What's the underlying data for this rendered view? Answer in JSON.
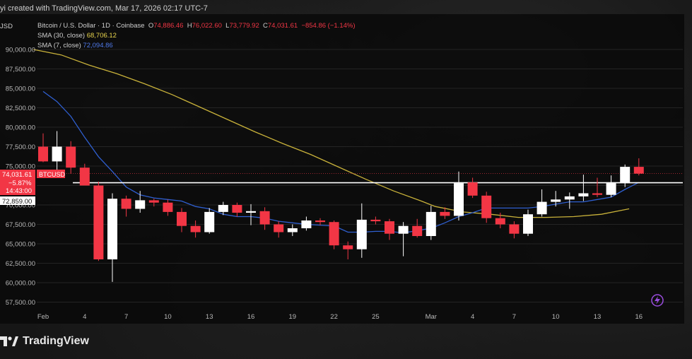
{
  "header": {
    "created_line": "yi created with TradingView.com, Mar 17, 2026 02:17 UTC-7",
    "symbol_currency": "JSD",
    "symbol_name": "Bitcoin / U.S. Dollar · 1D · Coinbase",
    "ohlc": {
      "o_label": "O",
      "o": "74,886.46",
      "h_label": "H",
      "h": "76,022.60",
      "l_label": "L",
      "l": "73,779.92",
      "c_label": "C",
      "c": "74,031.61",
      "change": "−854.86 (−1.14%)"
    },
    "sma30_label": "SMA (30, close)",
    "sma30_value": "68,706.12",
    "sma7_label": "SMA (7, close)",
    "sma7_value": "72,094.86"
  },
  "badges": {
    "price": "74,031.61",
    "ticker": "BTCUSD",
    "pct": "−5.87%",
    "countdown": "14:43:00",
    "line_price": "72,859.00"
  },
  "footer": {
    "brand": "TradingView"
  },
  "colors": {
    "up": "#ffffff",
    "down": "#f23645",
    "sma30": "#c9b23a",
    "sma7": "#2f5fd0",
    "hline": "#ffffff"
  },
  "chart_data": {
    "type": "candlestick",
    "y_ticks": [
      "90,000.00",
      "87,500.00",
      "85,000.00",
      "82,500.00",
      "80,000.00",
      "77,500.00",
      "75,000.00",
      "72,500.00",
      "70,000.00",
      "67,500.00",
      "65,000.00",
      "62,500.00",
      "60,000.00",
      "57,500.00"
    ],
    "y_tick_values": [
      90000,
      87500,
      85000,
      82500,
      80000,
      77500,
      75000,
      72500,
      70000,
      67500,
      65000,
      62500,
      60000,
      57500
    ],
    "x_ticks": [
      {
        "label": "Feb",
        "day": 0
      },
      {
        "label": "4",
        "day": 3
      },
      {
        "label": "7",
        "day": 6
      },
      {
        "label": "10",
        "day": 9
      },
      {
        "label": "13",
        "day": 12
      },
      {
        "label": "16",
        "day": 15
      },
      {
        "label": "19",
        "day": 18
      },
      {
        "label": "22",
        "day": 21
      },
      {
        "label": "25",
        "day": 24
      },
      {
        "label": "Mar",
        "day": 28
      },
      {
        "label": "4",
        "day": 31
      },
      {
        "label": "7",
        "day": 34
      },
      {
        "label": "10",
        "day": 37
      },
      {
        "label": "13",
        "day": 40
      },
      {
        "label": "16",
        "day": 43
      }
    ],
    "ylim": [
      56500,
      91000
    ],
    "hline": 72859,
    "candles": [
      {
        "day": 0,
        "o": 77500,
        "h": 79200,
        "l": 75500,
        "c": 75600
      },
      {
        "day": 1,
        "o": 75600,
        "h": 79500,
        "l": 74200,
        "c": 77500
      },
      {
        "day": 2,
        "o": 77500,
        "h": 78200,
        "l": 74000,
        "c": 74800
      },
      {
        "day": 3,
        "o": 74800,
        "h": 75300,
        "l": 73200,
        "c": 72500
      },
      {
        "day": 4,
        "o": 72500,
        "h": 73000,
        "l": 62800,
        "c": 63000
      },
      {
        "day": 5,
        "o": 63000,
        "h": 71500,
        "l": 60100,
        "c": 70800
      },
      {
        "day": 6,
        "o": 70800,
        "h": 71200,
        "l": 68500,
        "c": 69500
      },
      {
        "day": 7,
        "o": 69500,
        "h": 71800,
        "l": 69000,
        "c": 70600
      },
      {
        "day": 8,
        "o": 70600,
        "h": 70800,
        "l": 69800,
        "c": 70300
      },
      {
        "day": 9,
        "o": 70300,
        "h": 70700,
        "l": 68600,
        "c": 69100
      },
      {
        "day": 10,
        "o": 69100,
        "h": 69600,
        "l": 66500,
        "c": 67300
      },
      {
        "day": 11,
        "o": 67300,
        "h": 68000,
        "l": 65800,
        "c": 66500
      },
      {
        "day": 12,
        "o": 66500,
        "h": 69600,
        "l": 66300,
        "c": 69100
      },
      {
        "day": 13,
        "o": 69100,
        "h": 70400,
        "l": 68700,
        "c": 70000
      },
      {
        "day": 14,
        "o": 70000,
        "h": 70300,
        "l": 68500,
        "c": 69000
      },
      {
        "day": 15,
        "o": 69000,
        "h": 70100,
        "l": 67400,
        "c": 69200
      },
      {
        "day": 16,
        "o": 69200,
        "h": 69700,
        "l": 66800,
        "c": 67500
      },
      {
        "day": 17,
        "o": 67500,
        "h": 67900,
        "l": 65800,
        "c": 66500
      },
      {
        "day": 18,
        "o": 66500,
        "h": 67500,
        "l": 66000,
        "c": 67000
      },
      {
        "day": 19,
        "o": 67000,
        "h": 68500,
        "l": 66700,
        "c": 68000
      },
      {
        "day": 20,
        "o": 68000,
        "h": 68300,
        "l": 67400,
        "c": 67800
      },
      {
        "day": 21,
        "o": 67800,
        "h": 68000,
        "l": 64300,
        "c": 64800
      },
      {
        "day": 22,
        "o": 64800,
        "h": 65300,
        "l": 63000,
        "c": 64300
      },
      {
        "day": 23,
        "o": 64300,
        "h": 70200,
        "l": 63200,
        "c": 68100
      },
      {
        "day": 24,
        "o": 68100,
        "h": 68500,
        "l": 67500,
        "c": 67900
      },
      {
        "day": 25,
        "o": 67900,
        "h": 68200,
        "l": 65500,
        "c": 66300
      },
      {
        "day": 26,
        "o": 66300,
        "h": 67800,
        "l": 63400,
        "c": 67300
      },
      {
        "day": 27,
        "o": 67300,
        "h": 68200,
        "l": 65800,
        "c": 66000
      },
      {
        "day": 28,
        "o": 66000,
        "h": 69900,
        "l": 65500,
        "c": 69100
      },
      {
        "day": 29,
        "o": 69100,
        "h": 69700,
        "l": 68200,
        "c": 68600
      },
      {
        "day": 30,
        "o": 68600,
        "h": 74300,
        "l": 68000,
        "c": 72900
      },
      {
        "day": 31,
        "o": 72900,
        "h": 73500,
        "l": 70900,
        "c": 71200
      },
      {
        "day": 32,
        "o": 71200,
        "h": 71700,
        "l": 67700,
        "c": 68300
      },
      {
        "day": 33,
        "o": 68300,
        "h": 69000,
        "l": 67000,
        "c": 67500
      },
      {
        "day": 34,
        "o": 67500,
        "h": 67900,
        "l": 65700,
        "c": 66300
      },
      {
        "day": 35,
        "o": 66300,
        "h": 69400,
        "l": 66000,
        "c": 68800
      },
      {
        "day": 36,
        "o": 68800,
        "h": 72000,
        "l": 68500,
        "c": 70400
      },
      {
        "day": 37,
        "o": 70400,
        "h": 71800,
        "l": 69800,
        "c": 70700
      },
      {
        "day": 38,
        "o": 70700,
        "h": 71600,
        "l": 69500,
        "c": 71100
      },
      {
        "day": 39,
        "o": 71100,
        "h": 73900,
        "l": 70500,
        "c": 71500
      },
      {
        "day": 40,
        "o": 71500,
        "h": 73500,
        "l": 71000,
        "c": 71300
      },
      {
        "day": 41,
        "o": 71300,
        "h": 73800,
        "l": 71000,
        "c": 72800
      },
      {
        "day": 42,
        "o": 72800,
        "h": 75200,
        "l": 72300,
        "c": 74900
      },
      {
        "day": 43,
        "o": 74900,
        "h": 76000,
        "l": 73800,
        "c": 74031
      }
    ],
    "sma30": [
      [
        0,
        90000
      ],
      [
        2,
        89300
      ],
      [
        4,
        88000
      ],
      [
        6,
        86900
      ],
      [
        8,
        85600
      ],
      [
        10,
        84200
      ],
      [
        12,
        82600
      ],
      [
        14,
        81000
      ],
      [
        16,
        79400
      ],
      [
        18,
        77900
      ],
      [
        20,
        76500
      ],
      [
        22,
        74900
      ],
      [
        24,
        73300
      ],
      [
        26,
        71800
      ],
      [
        28,
        70500
      ],
      [
        29,
        69800
      ],
      [
        31,
        69100
      ],
      [
        33,
        68800
      ],
      [
        35,
        68400
      ],
      [
        37,
        68400
      ],
      [
        39,
        68500
      ],
      [
        41,
        68800
      ],
      [
        43,
        69500
      ]
    ],
    "sma7": [
      [
        0,
        84600
      ],
      [
        1,
        83300
      ],
      [
        2,
        81400
      ],
      [
        3,
        78700
      ],
      [
        4,
        76200
      ],
      [
        5,
        74300
      ],
      [
        6,
        72300
      ],
      [
        7,
        71300
      ],
      [
        8,
        70900
      ],
      [
        9,
        70700
      ],
      [
        10,
        70500
      ],
      [
        11,
        69800
      ],
      [
        12,
        69500
      ],
      [
        13,
        68800
      ],
      [
        14,
        68500
      ],
      [
        15,
        68500
      ],
      [
        16,
        68300
      ],
      [
        17,
        67900
      ],
      [
        18,
        67700
      ],
      [
        19,
        67500
      ],
      [
        20,
        67400
      ],
      [
        21,
        67300
      ],
      [
        22,
        66500
      ],
      [
        23,
        66500
      ],
      [
        24,
        66600
      ],
      [
        25,
        66600
      ],
      [
        26,
        66400
      ],
      [
        27,
        66700
      ],
      [
        28,
        67000
      ],
      [
        29,
        67700
      ],
      [
        30,
        68500
      ],
      [
        31,
        69000
      ],
      [
        32,
        69600
      ],
      [
        33,
        69600
      ],
      [
        34,
        69600
      ],
      [
        35,
        69600
      ],
      [
        36,
        69800
      ],
      [
        37,
        70100
      ],
      [
        38,
        70400
      ],
      [
        39,
        70400
      ],
      [
        40,
        70700
      ],
      [
        41,
        71000
      ],
      [
        42,
        72000
      ],
      [
        43,
        72900
      ]
    ]
  }
}
